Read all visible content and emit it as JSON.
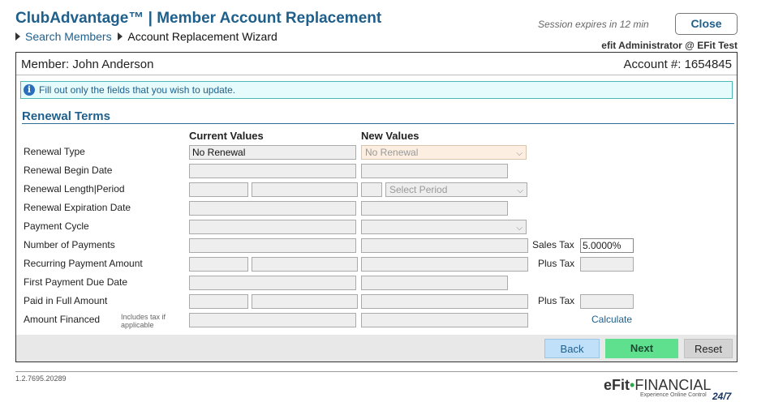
{
  "header": {
    "title": "ClubAdvantage™ | Member Account Replacement",
    "breadcrumb": {
      "link": "Search Members",
      "current": "Account Replacement Wizard"
    },
    "session": "Session expires in 12 min",
    "close_label": "Close",
    "user": "efit Administrator @ EFit Test"
  },
  "member": {
    "name_text": "Member: John Anderson",
    "account_text": "Account #: 1654845"
  },
  "info": {
    "icon": "info-icon",
    "glyph": "i",
    "text": "Fill out only the fields that you wish to update."
  },
  "section": {
    "title": "Renewal Terms",
    "current_header": "Current Values",
    "new_header": "New Values"
  },
  "rows": {
    "renewal_type": {
      "label": "Renewal Type",
      "current": "No Renewal",
      "new_value": "No Renewal"
    },
    "begin_date": {
      "label": "Renewal Begin Date"
    },
    "length_period": {
      "label": "Renewal Length|Period",
      "period_placeholder": "Select Period"
    },
    "expiration": {
      "label": "Renewal Expiration Date"
    },
    "payment_cycle": {
      "label": "Payment Cycle"
    },
    "num_payments": {
      "label": "Number of Payments",
      "sales_tax_label": "Sales Tax",
      "sales_tax_value": "5.0000%"
    },
    "recurring": {
      "label": "Recurring Payment Amount",
      "plus_tax_label": "Plus Tax"
    },
    "first_due": {
      "label": "First Payment Due Date"
    },
    "paid_in_full": {
      "label": "Paid in Full Amount",
      "plus_tax_label": "Plus Tax"
    },
    "financed": {
      "label": "Amount Financed",
      "note_line1": "Includes tax if",
      "note_line2": "applicable",
      "calculate_label": "Calculate"
    }
  },
  "footer": {
    "back_label": "Back",
    "next_label": "Next",
    "reset_label": "Reset",
    "version": "1.2.7695.20289"
  },
  "logo": {
    "efit": "eFit",
    "dot": "•",
    "financial": "FINANCIAL",
    "tagline": "Experience Online Control",
    "suffix": "24/7"
  },
  "colors": {
    "accent": "#1f5f8b",
    "next_button": "#5fe08f",
    "back_button": "#bfe0f8",
    "info_bg": "#e6fbfb"
  }
}
